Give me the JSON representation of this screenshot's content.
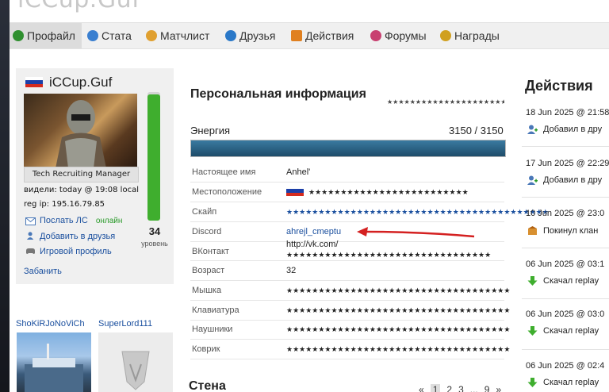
{
  "site_title": "iCCup.Guf",
  "nav": [
    {
      "label": "Профайл",
      "color": "#2f8f2f"
    },
    {
      "label": "Стата",
      "color": "#3a7fd0"
    },
    {
      "label": "Матчлист",
      "color": "#e0a030"
    },
    {
      "label": "Друзья",
      "color": "#2a78c8"
    },
    {
      "label": "Действия",
      "color": "#e08020"
    },
    {
      "label": "Форумы",
      "color": "#c84070"
    },
    {
      "label": "Награды",
      "color": "#d0a020"
    }
  ],
  "profile": {
    "username": "iCCup.Guf",
    "role": "Tech Recruiting Manager",
    "seen": "видели: today @ 19:08 local",
    "reg_ip": "reg ip: 195.16.79.85",
    "send_pm": "Послать ЛС",
    "online": "онлайн",
    "add_friend": "Добавить в друзья",
    "game_profile": "Игровой профиль",
    "ban": "Забанить",
    "level": "34",
    "level_label": "уровень",
    "level_fill": 0.98
  },
  "friends": [
    {
      "name": "ShoKiRJoNoViCh"
    },
    {
      "name": "SuperLord111"
    }
  ],
  "personal": {
    "title": "Персональная информация",
    "title_stars": "★★★★★★★★★★★★★★★★★★★★★",
    "energy_label": "Энергия",
    "energy_value": "3150 / 3150",
    "energy_fill": 1.0,
    "rows": [
      {
        "label": "Настоящее имя",
        "value": "Anhel'"
      },
      {
        "label": "Местоположение",
        "value": "★★★★★★★★★★★★★★★★★★★★★★★★★"
      },
      {
        "label": "Скайп",
        "value": "★★★★★★★★★★★★★★★★★★★★★★★★★★★★★★★★★★★★★★★★★"
      },
      {
        "label": "Discord",
        "value": "ahrejl_cmeptu"
      },
      {
        "label": "ВКонтакт",
        "value": "http://vk.com/",
        "value2": "★★★★★★★★★★★★★★★★★★★★★★★★★★★★★★★★"
      },
      {
        "label": "Возраст",
        "value": "32"
      },
      {
        "label": "Мышка",
        "value": "★★★★★★★★★★★★★★★★★★★★★★★★★★★★★★★★★★★"
      },
      {
        "label": "Клавиатура",
        "value": "★★★★★★★★★★★★★★★★★★★★★★★★★★★★★★★★★★★"
      },
      {
        "label": "Наушники",
        "value": "★★★★★★★★★★★★★★★★★★★★★★★★★★★★★★★★★★★"
      },
      {
        "label": "Коврик",
        "value": "★★★★★★★★★★★★★★★★★★★★★★★★★★★★★★★★★★★"
      }
    ]
  },
  "wall": {
    "title": "Стена",
    "pages": [
      "«",
      "1",
      "2",
      "3",
      "...",
      "9",
      "»"
    ]
  },
  "actions": {
    "title": "Действия",
    "items": [
      {
        "date": "18 Jun 2025 @ 21:58",
        "text": "Добавил в дру",
        "icon": "add-friend-icon"
      },
      {
        "date": "17 Jun 2025 @ 22:29",
        "text": "Добавил в дру",
        "icon": "add-friend-icon"
      },
      {
        "date": "10 Jun 2025 @ 23:0",
        "text": "Покинул клан",
        "icon": "clan-icon"
      },
      {
        "date": "06 Jun 2025 @ 03:1",
        "text": "Скачал replay",
        "icon": "download-icon"
      },
      {
        "date": "06 Jun 2025 @ 03:0",
        "text": "Скачал replay",
        "icon": "download-icon"
      },
      {
        "date": "06 Jun 2025 @ 02:4",
        "text": "Скачал replay",
        "icon": "download-icon"
      }
    ]
  },
  "colors": {
    "accent_link": "#1a4f9e",
    "level_green": "#3fae2e",
    "energy_fill": "#2a5f82",
    "annotation_arrow": "#d42020"
  }
}
